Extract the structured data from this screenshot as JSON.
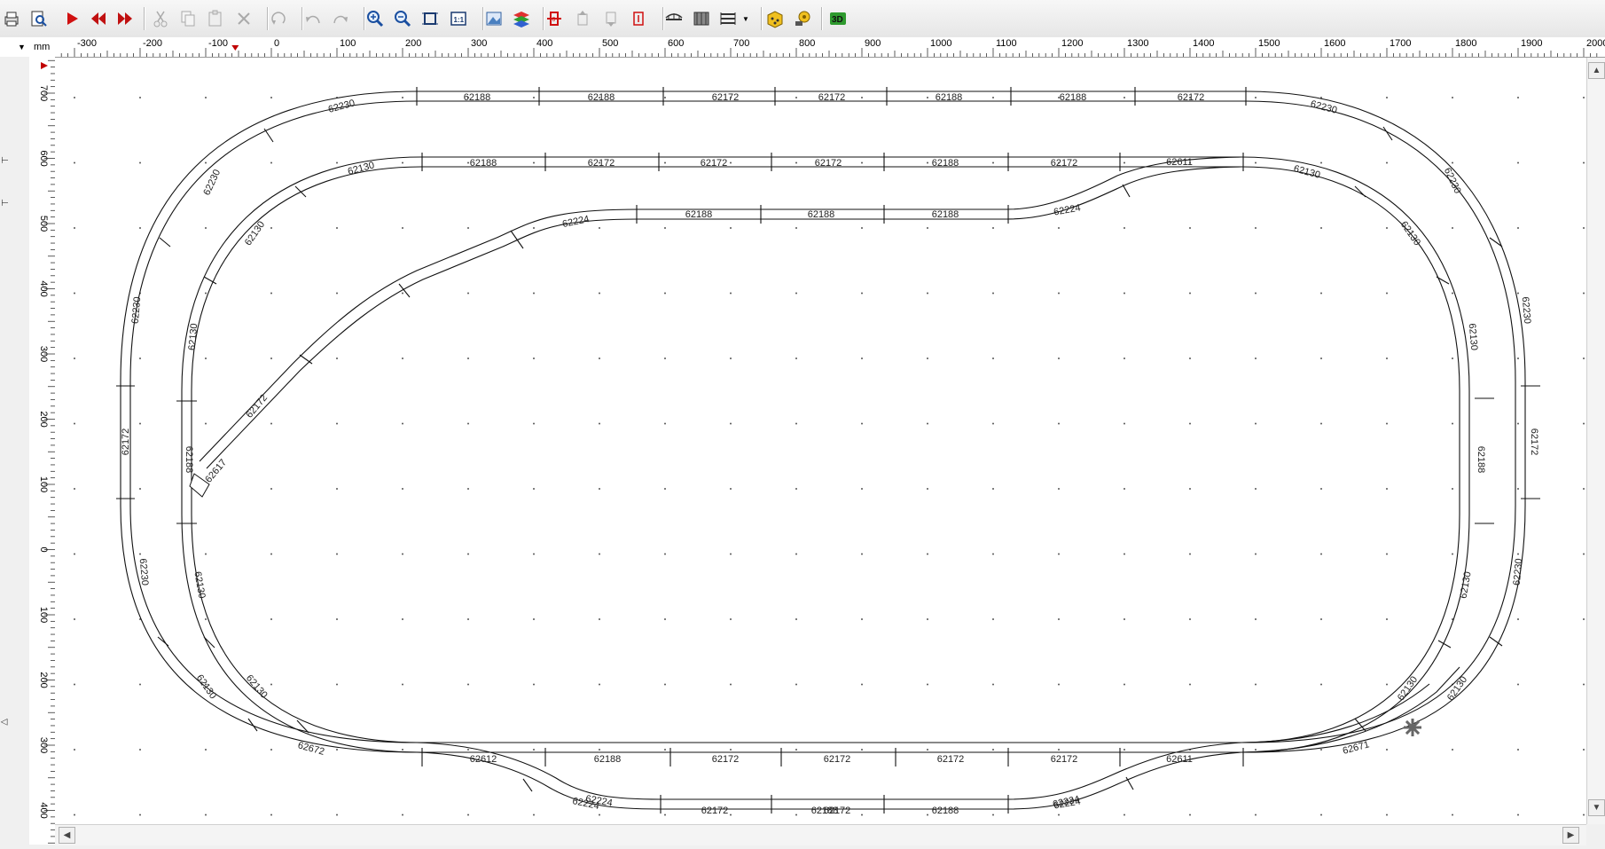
{
  "toolbar": {
    "buttons": [
      {
        "name": "print-icon",
        "x": 12
      },
      {
        "name": "print-preview-icon",
        "x": 42
      },
      {
        "name": "run-icon",
        "x": 80
      },
      {
        "name": "step-back-icon",
        "x": 110
      },
      {
        "name": "step-forward-icon",
        "x": 140
      },
      {
        "name": "cut-icon",
        "x": 180
      },
      {
        "name": "copy-icon",
        "x": 211
      },
      {
        "name": "paste-icon",
        "x": 242
      },
      {
        "name": "delete-icon",
        "x": 274
      },
      {
        "name": "rotate-icon",
        "x": 313
      },
      {
        "name": "undo-icon",
        "x": 352
      },
      {
        "name": "redo-icon",
        "x": 383
      },
      {
        "name": "zoom-in-icon",
        "x": 422
      },
      {
        "name": "zoom-out-icon",
        "x": 453
      },
      {
        "name": "zoom-fit-icon",
        "x": 484
      },
      {
        "name": "zoom-actual-icon",
        "x": 516
      },
      {
        "name": "background-image-icon",
        "x": 556
      },
      {
        "name": "layers-icon",
        "x": 587
      },
      {
        "name": "height-tool-icon",
        "x": 624
      },
      {
        "name": "ramp-up-icon",
        "x": 656
      },
      {
        "name": "ramp-down-icon",
        "x": 688
      },
      {
        "name": "height-marker-icon",
        "x": 719
      },
      {
        "name": "bridge-icon",
        "x": 759
      },
      {
        "name": "tunnel-icon",
        "x": 790
      },
      {
        "name": "track-parts-icon",
        "x": 820
      },
      {
        "name": "parts-list-icon",
        "x": 872
      },
      {
        "name": "measure-icon",
        "x": 904
      },
      {
        "name": "view-3d-icon",
        "x": 944
      }
    ],
    "view_3d_label": "3D"
  },
  "ruler": {
    "unit": "mm",
    "x_ticks": [
      "-300",
      "-200",
      "-100",
      "0",
      "100",
      "200",
      "300",
      "400",
      "500",
      "600",
      "700",
      "800",
      "900",
      "1000",
      "1100",
      "1200",
      "1300",
      "1400",
      "1500",
      "1600",
      "1700",
      "1800",
      "1900",
      "2000"
    ],
    "y_ticks": [
      "700",
      "600",
      "500",
      "400",
      "300",
      "200",
      "100",
      "0",
      "100",
      "200",
      "300",
      "400"
    ]
  },
  "track_labels": {
    "outer_top": [
      "62230",
      "62188",
      "62188",
      "62172",
      "62172",
      "62188",
      "62188",
      "62172",
      "62230"
    ],
    "inner_top": [
      "62130",
      "62188",
      "62172",
      "62172",
      "62172",
      "62188",
      "62172",
      "62611",
      "62130"
    ],
    "siding": [
      "62224",
      "62188",
      "62188",
      "62188",
      "62224",
      "62224",
      "62188",
      "62224",
      "62172",
      "62617"
    ],
    "outer_left": [
      "62230",
      "62230",
      "62172",
      "62230",
      "62130"
    ],
    "inner_left": [
      "62130",
      "62130",
      "62188",
      "62130",
      "62130"
    ],
    "outer_right": [
      "62230",
      "62230",
      "62172",
      "62230",
      "62130"
    ],
    "inner_right": [
      "62130",
      "62130",
      "62188",
      "62130",
      "62130"
    ],
    "bottom_inner": [
      "62672",
      "62612",
      "62188",
      "62172",
      "62172",
      "62172",
      "62172",
      "62611",
      "62671"
    ],
    "bottom_outer": [
      "62224",
      "62172",
      "62172",
      "62188",
      "62224"
    ]
  }
}
